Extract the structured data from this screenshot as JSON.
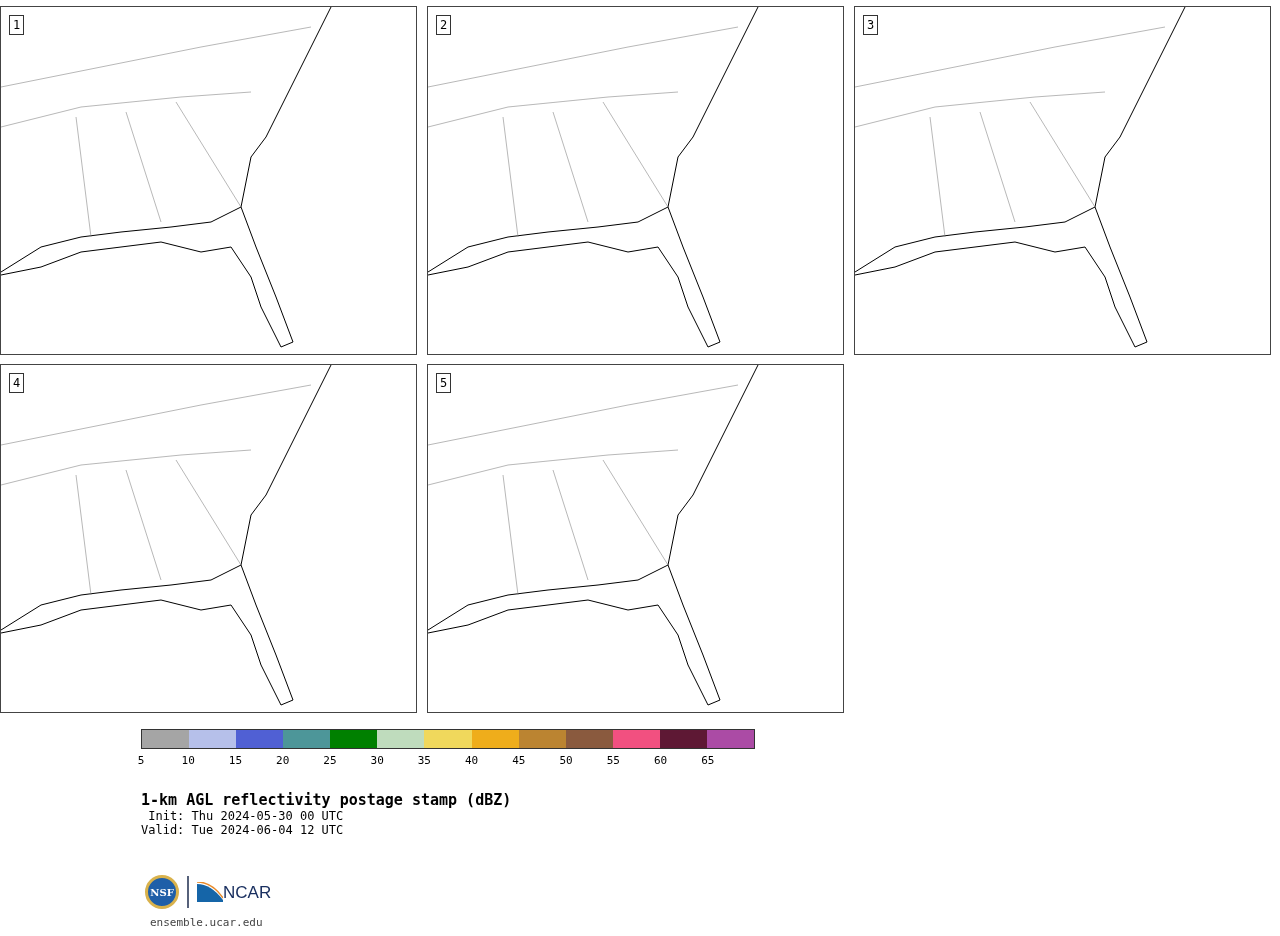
{
  "panels": [
    {
      "label": "1"
    },
    {
      "label": "2"
    },
    {
      "label": "3"
    },
    {
      "label": "4"
    },
    {
      "label": "5"
    }
  ],
  "legend": [
    {
      "label": "5",
      "color": "#a5a5a5"
    },
    {
      "label": "10",
      "color": "#b6c0ea"
    },
    {
      "label": "15",
      "color": "#5060d4"
    },
    {
      "label": "20",
      "color": "#4d9699"
    },
    {
      "label": "25",
      "color": "#008000"
    },
    {
      "label": "30",
      "color": "#bfdcbd"
    },
    {
      "label": "35",
      "color": "#f0d85c"
    },
    {
      "label": "40",
      "color": "#efad1b"
    },
    {
      "label": "45",
      "color": "#bb8431"
    },
    {
      "label": "50",
      "color": "#8a5a3e"
    },
    {
      "label": "55",
      "color": "#f25080"
    },
    {
      "label": "60",
      "color": "#5e1834"
    },
    {
      "label": "65",
      "color": "#ab4ba5"
    }
  ],
  "title": "1-km AGL reflectivity postage stamp (dBZ)",
  "init": " Init: Thu 2024-05-30 00 UTC",
  "valid": "Valid: Tue 2024-06-04 12 UTC",
  "logo": {
    "nsf": "NSF",
    "ncar": "NCAR"
  },
  "website": "ensemble.ucar.edu"
}
